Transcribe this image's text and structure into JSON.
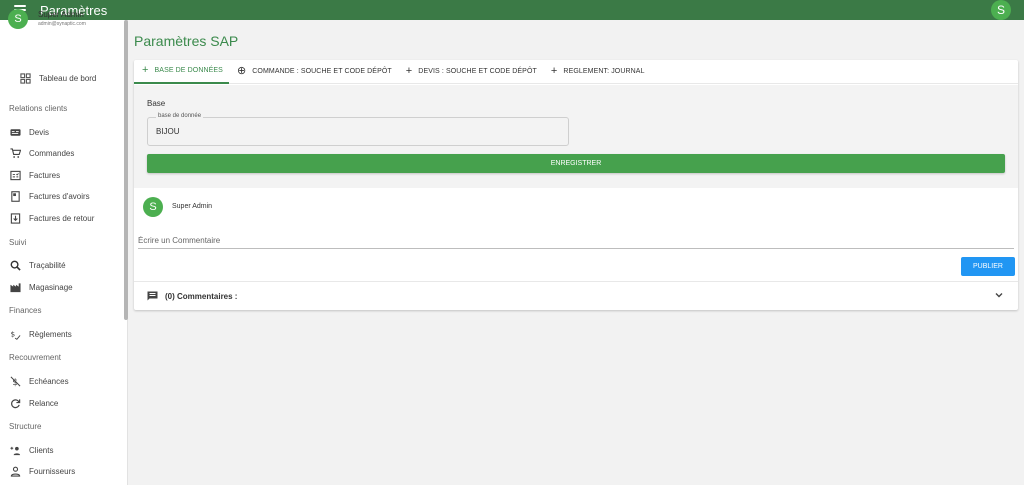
{
  "topbar": {
    "title": "Paramètres",
    "avatar_initial": "S"
  },
  "user": {
    "initial": "S",
    "name": "Super Admin",
    "email": "admin@synaptic.com"
  },
  "sidebar": {
    "dashboard": "Tableau de bord",
    "sections": [
      {
        "title": "Relations clients",
        "items": [
          "Devis",
          "Commandes",
          "Factures",
          "Factures d'avoirs",
          "Factures de retour"
        ]
      },
      {
        "title": "Suivi",
        "items": [
          "Traçabilité",
          "Magasinage"
        ]
      },
      {
        "title": "Finances",
        "items": [
          "Règlements"
        ]
      },
      {
        "title": "Recouvrement",
        "items": [
          "Echéances",
          "Relance"
        ]
      },
      {
        "title": "Structure",
        "items": [
          "Clients",
          "Fournisseurs"
        ]
      }
    ]
  },
  "main": {
    "title": "Paramètres SAP",
    "tabs": [
      {
        "label": "BASE DE DONNÉES",
        "icon": "plus-icon",
        "active": true
      },
      {
        "label": "COMMANDE : SOUCHE ET CODE DÉPÔT",
        "icon": "plus-circle-icon",
        "active": false
      },
      {
        "label": "DEVIS : SOUCHE ET CODE DÉPÔT",
        "icon": "plus-icon",
        "active": false
      },
      {
        "label": "REGLEMENT: JOURNAL",
        "icon": "plus-icon",
        "active": false
      }
    ],
    "panel": {
      "heading": "Base",
      "field_label": "base de donnée",
      "field_value": "BIJOU",
      "save_label": "ENREGISTRER"
    },
    "comments": {
      "avatar_initial": "S",
      "user": "Super Admin",
      "placeholder": "Écrire un Commentaire",
      "publish_label": "PUBLIER",
      "count_label": "(0) Commentaires :"
    }
  },
  "colors": {
    "primary": "#3b7a46",
    "accent": "#46a14d",
    "publish": "#2196f3"
  }
}
